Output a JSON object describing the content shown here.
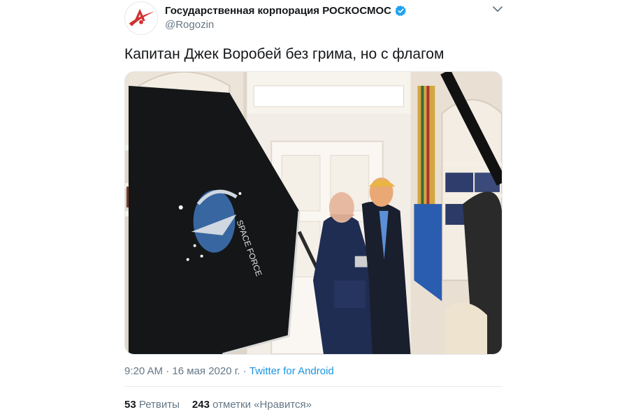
{
  "author": {
    "display_name": "Государственная корпорация РОСКОСМОС",
    "handle": "@Rogozin",
    "verified_icon": "verified-badge-icon",
    "avatar_icon": "roscosmos-logo-icon"
  },
  "menu_icon": "chevron-down-icon",
  "tweet": {
    "text": "Капитан Джек Воробей без грима, но с флагом"
  },
  "meta": {
    "time": "9:20 AM",
    "separator": " · ",
    "date": "16 мая 2020 г.",
    "separator2": " · ",
    "source": "Twitter for Android"
  },
  "stats": {
    "retweets_count": "53",
    "retweets_label": "Ретвиты",
    "likes_count": "243",
    "likes_label": "отметки «Нравится»"
  },
  "colors": {
    "accent": "#1b95e0",
    "verified": "#1da1f2",
    "secondary_text": "#657786",
    "roscosmos_red": "#d32f2f"
  }
}
